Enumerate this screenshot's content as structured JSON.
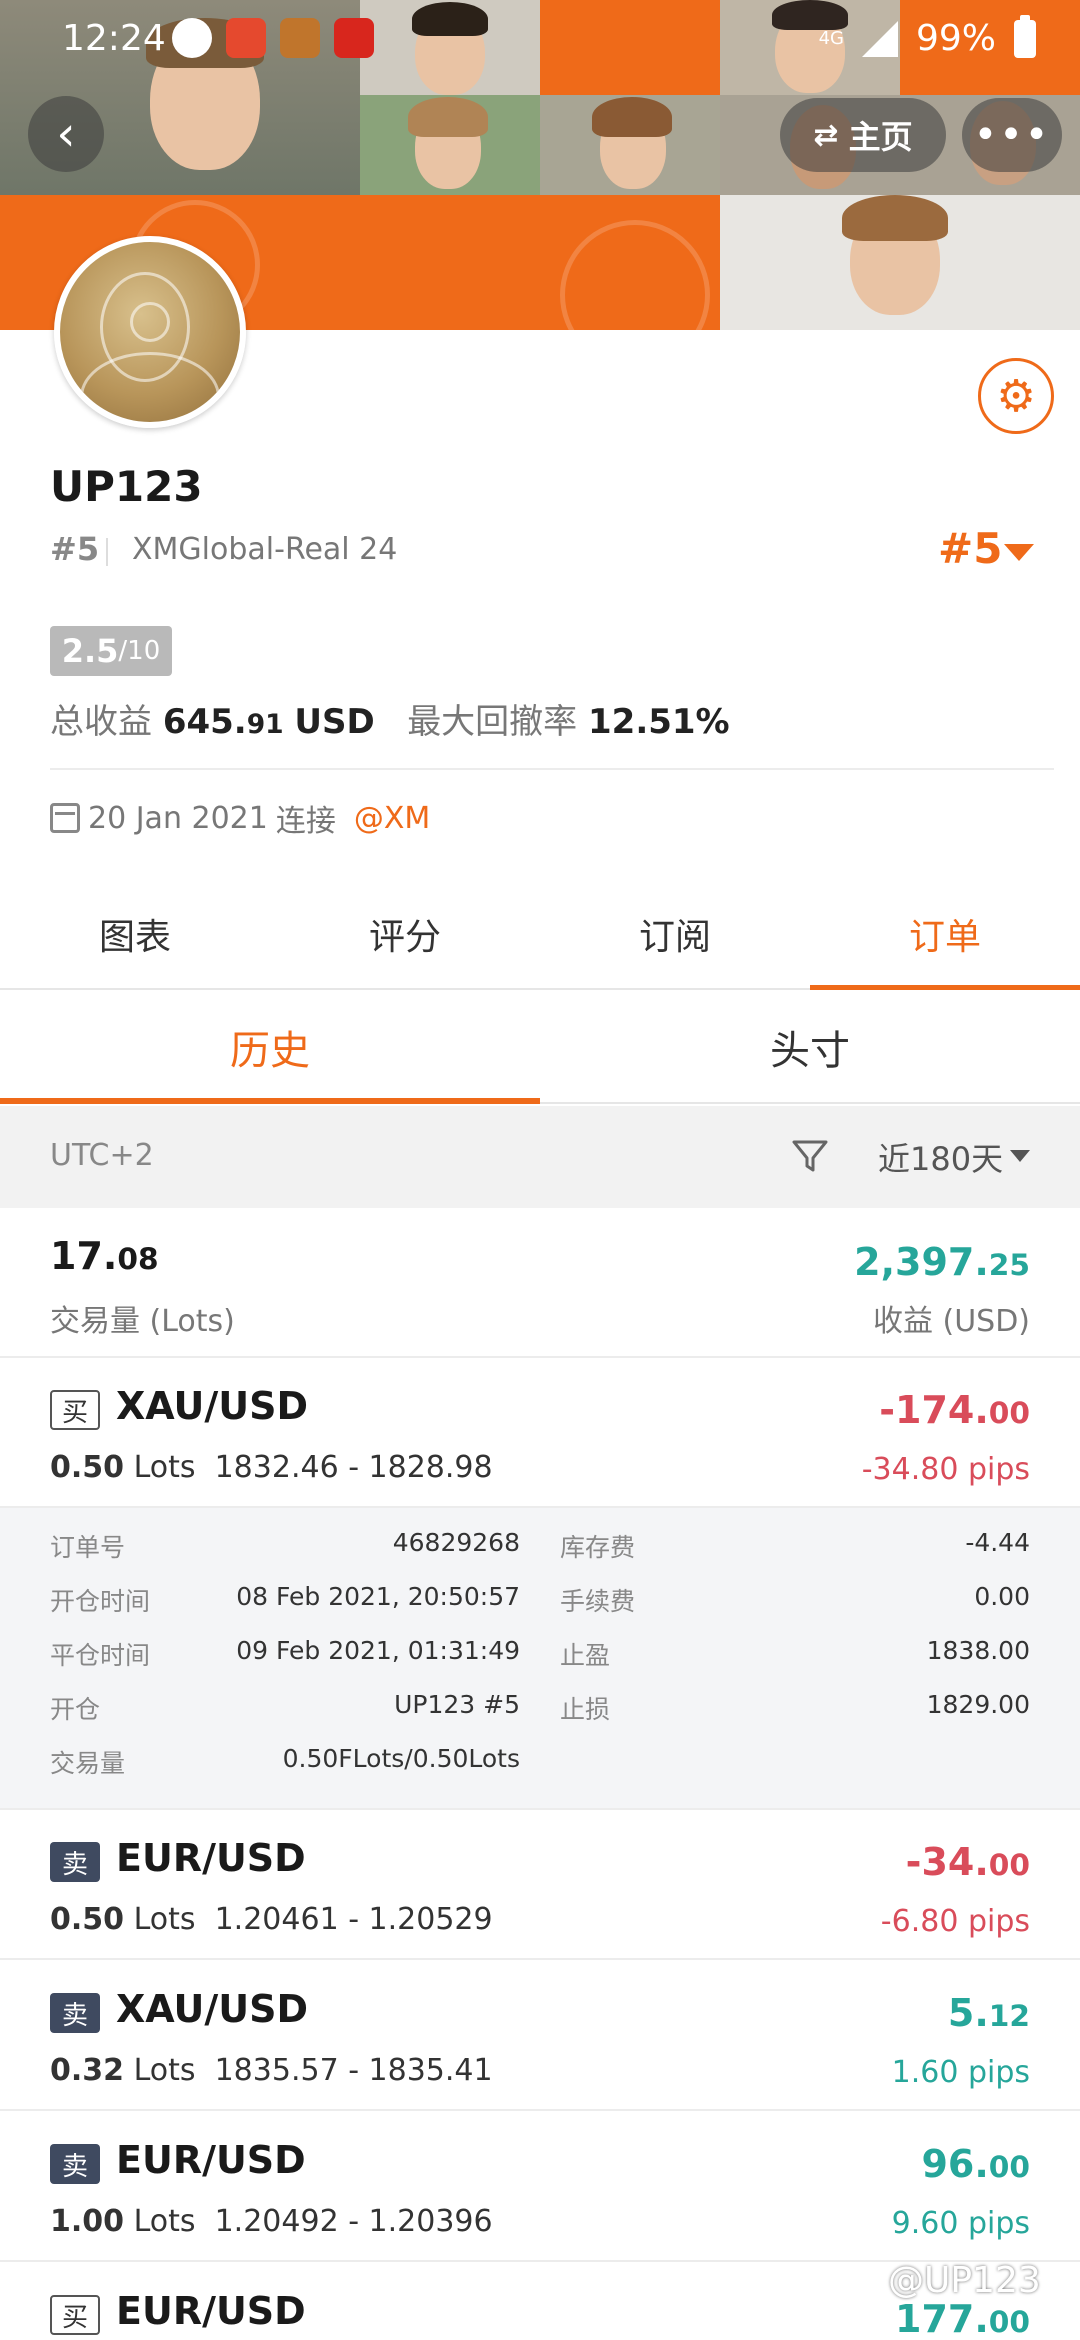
{
  "status_bar": {
    "time": "12:24",
    "network": "4G",
    "battery": "99%"
  },
  "header": {
    "back_icon": "back-arrow-icon",
    "home_label": "主页",
    "more_icon": "more-dots-icon",
    "accent_color": "#ef6a19"
  },
  "profile": {
    "name": "UP123",
    "rank_small": "#5",
    "server": "XMGlobal-Real 24",
    "rank_big": "#5",
    "score": "2.5",
    "score_denominator": "/10",
    "total_profit_label": "总收益",
    "total_profit_int": "645.",
    "total_profit_dec": "91",
    "total_profit_unit": "USD",
    "drawdown_label": "最大回撤率",
    "drawdown_value": "12.51%",
    "joined_date": "20 Jan 2021",
    "joined_label": "连接",
    "broker": "@XM"
  },
  "tabs": [
    "图表",
    "评分",
    "订阅",
    "订单"
  ],
  "active_tab": 3,
  "subtabs": [
    "历史",
    "头寸"
  ],
  "active_subtab": 0,
  "filter": {
    "timezone": "UTC+2",
    "period": "近180天"
  },
  "summary": {
    "lots_int": "17.",
    "lots_dec": "08",
    "lots_label": "交易量 (Lots)",
    "profit_int": "2,397.",
    "profit_dec": "25",
    "profit_label": "收益 (USD)"
  },
  "orders": [
    {
      "side": "买",
      "symbol": "XAU/USD",
      "lots": "0.50",
      "lots_unit": "Lots",
      "prices": "1832.46 - 1828.98",
      "pnl_int": "-174.",
      "pnl_dec": "00",
      "pips": "-34.80 pips"
    },
    {
      "side": "卖",
      "symbol": "EUR/USD",
      "lots": "0.50",
      "lots_unit": "Lots",
      "prices": "1.20461 - 1.20529",
      "pnl_int": "-34.",
      "pnl_dec": "00",
      "pips": "-6.80 pips"
    },
    {
      "side": "卖",
      "symbol": "XAU/USD",
      "lots": "0.32",
      "lots_unit": "Lots",
      "prices": "1835.57 - 1835.41",
      "pnl_int": "5.",
      "pnl_dec": "12",
      "pips": "1.60 pips"
    },
    {
      "side": "卖",
      "symbol": "EUR/USD",
      "lots": "1.00",
      "lots_unit": "Lots",
      "prices": "1.20492 - 1.20396",
      "pnl_int": "96.",
      "pnl_dec": "00",
      "pips": "9.60 pips"
    },
    {
      "side": "买",
      "symbol": "EUR/USD",
      "pnl_int": "177.",
      "pnl_dec": "00"
    }
  ],
  "order_detail": {
    "order_no_label": "订单号",
    "order_no": "46829268",
    "swap_label": "库存费",
    "swap": "-4.44",
    "open_time_label": "开仓时间",
    "open_time": "08 Feb 2021, 20:50:57",
    "commission_label": "手续费",
    "commission": "0.00",
    "close_time_label": "平仓时间",
    "close_time": "09 Feb 2021, 01:31:49",
    "tp_label": "止盈",
    "tp": "1838.00",
    "opened_by_label": "开仓",
    "opened_by": "UP123  #5",
    "sl_label": "止损",
    "sl": "1829.00",
    "volume_label": "交易量",
    "volume": "0.50FLots/0.50Lots"
  },
  "watermark": "@UP123"
}
